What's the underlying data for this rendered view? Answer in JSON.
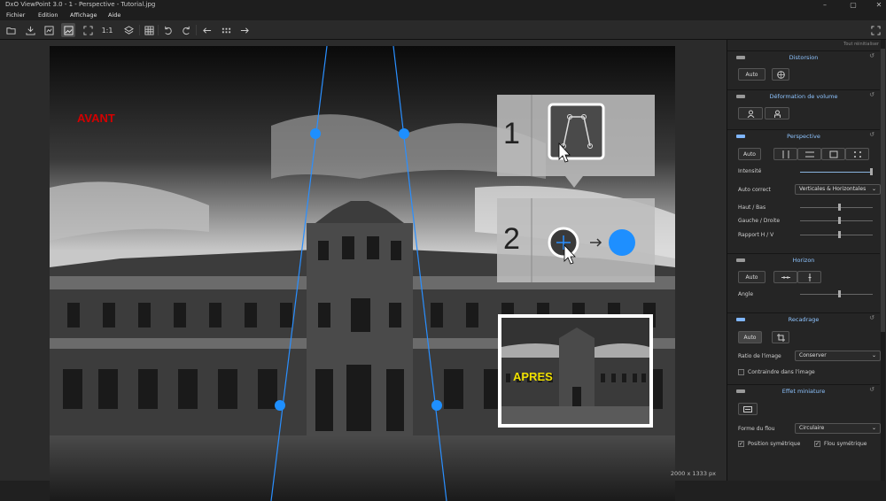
{
  "window": {
    "title": "DxO ViewPoint 3.0 - 1 - Perspective - Tutorial.jpg",
    "min": "–",
    "max": "▢",
    "close": "✕"
  },
  "menu": [
    "Fichier",
    "Edition",
    "Affichage",
    "Aide"
  ],
  "toolbar": {
    "one_to_one": "1:1"
  },
  "viewer": {
    "avant": "AVANT",
    "apres": "APRES",
    "step1": "1",
    "step2": "2",
    "dims": "2000 x 1333 px"
  },
  "panel": {
    "reset_all": "Tout réinitialiser",
    "distorsion": {
      "title": "Distorsion",
      "auto": "Auto"
    },
    "deformation": {
      "title": "Déformation de volume"
    },
    "perspective": {
      "title": "Perspective",
      "auto": "Auto",
      "intensite": "Intensité",
      "auto_correct_label": "Auto correct",
      "auto_correct_value": "Verticales & Horizontales",
      "haut_bas": "Haut / Bas",
      "gauche_droite": "Gauche / Droite",
      "rapport": "Rapport H / V"
    },
    "horizon": {
      "title": "Horizon",
      "auto": "Auto",
      "angle": "Angle"
    },
    "recadrage": {
      "title": "Recadrage",
      "auto": "Auto",
      "ratio_label": "Ratio de l'image",
      "ratio_value": "Conserver",
      "contraindre": "Contraindre dans l'image"
    },
    "miniature": {
      "title": "Effet miniature",
      "forme_label": "Forme du flou",
      "forme_value": "Circulaire",
      "position_sym": "Position symétrique",
      "flou_sym": "Flou symétrique"
    }
  },
  "colors": {
    "accent": "#8ec4ff",
    "handle": "#1e8fff",
    "avant": "#d40000",
    "apres": "#f0e000"
  }
}
